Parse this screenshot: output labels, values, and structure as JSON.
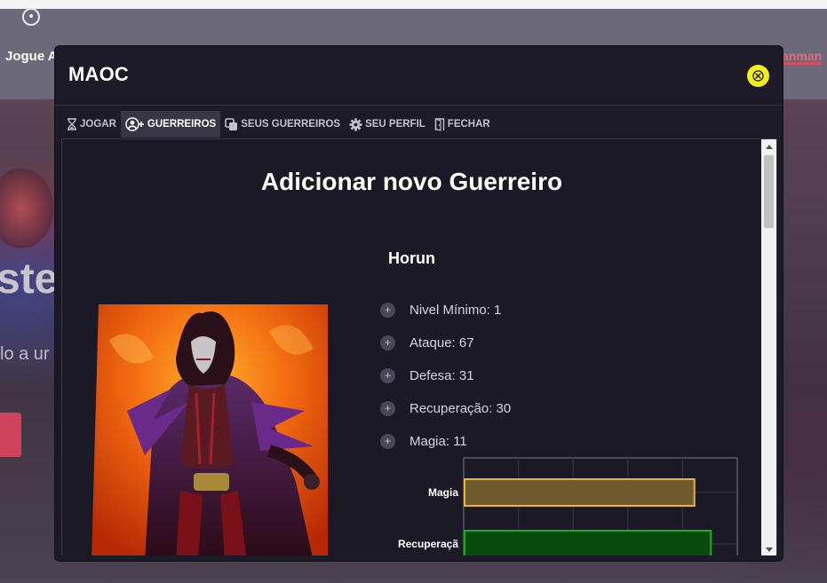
{
  "background": {
    "nav_text": "Jogue A",
    "right_text": "anman",
    "big_text": "ste",
    "small_text": "lo a ur"
  },
  "modal": {
    "title": "MAOC",
    "tabs": [
      {
        "label": "JOGAR",
        "icon": "hourglass-icon",
        "active": false
      },
      {
        "label": "GUERREIROS",
        "icon": "add-user-icon",
        "active": true
      },
      {
        "label": "SEUS GUERREIROS",
        "icon": "copy-icon",
        "active": false
      },
      {
        "label": "SEU PERFIL",
        "icon": "gear-icon",
        "active": false
      },
      {
        "label": "FECHAR",
        "icon": "door-icon",
        "active": false
      }
    ],
    "heading": "Adicionar novo Guerreiro",
    "warrior": {
      "name": "Horun",
      "stats": [
        {
          "label": "Nivel Mínimo: 1"
        },
        {
          "label": "Ataque: 67"
        },
        {
          "label": "Defesa: 31"
        },
        {
          "label": "Recuperação: 30"
        },
        {
          "label": "Magia: 11"
        }
      ]
    }
  },
  "colors": {
    "accent_close": "#f4f014",
    "bar_magia": "#c9a033",
    "bar_recuperacao": "#0f7a10"
  },
  "chart_data": {
    "type": "bar",
    "orientation": "horizontal",
    "categories": [
      "Magia",
      "Recuperaçã"
    ],
    "bars": [
      {
        "category": "Magia",
        "fill": "#6e5a2e",
        "stroke": "#e8b53a",
        "extent": 0.84
      },
      {
        "category": "Recuperaçã",
        "fill": "#0a4a0e",
        "stroke": "#14b018",
        "extent": 0.9
      }
    ],
    "grid": true,
    "vertical_gridlines": 5
  }
}
